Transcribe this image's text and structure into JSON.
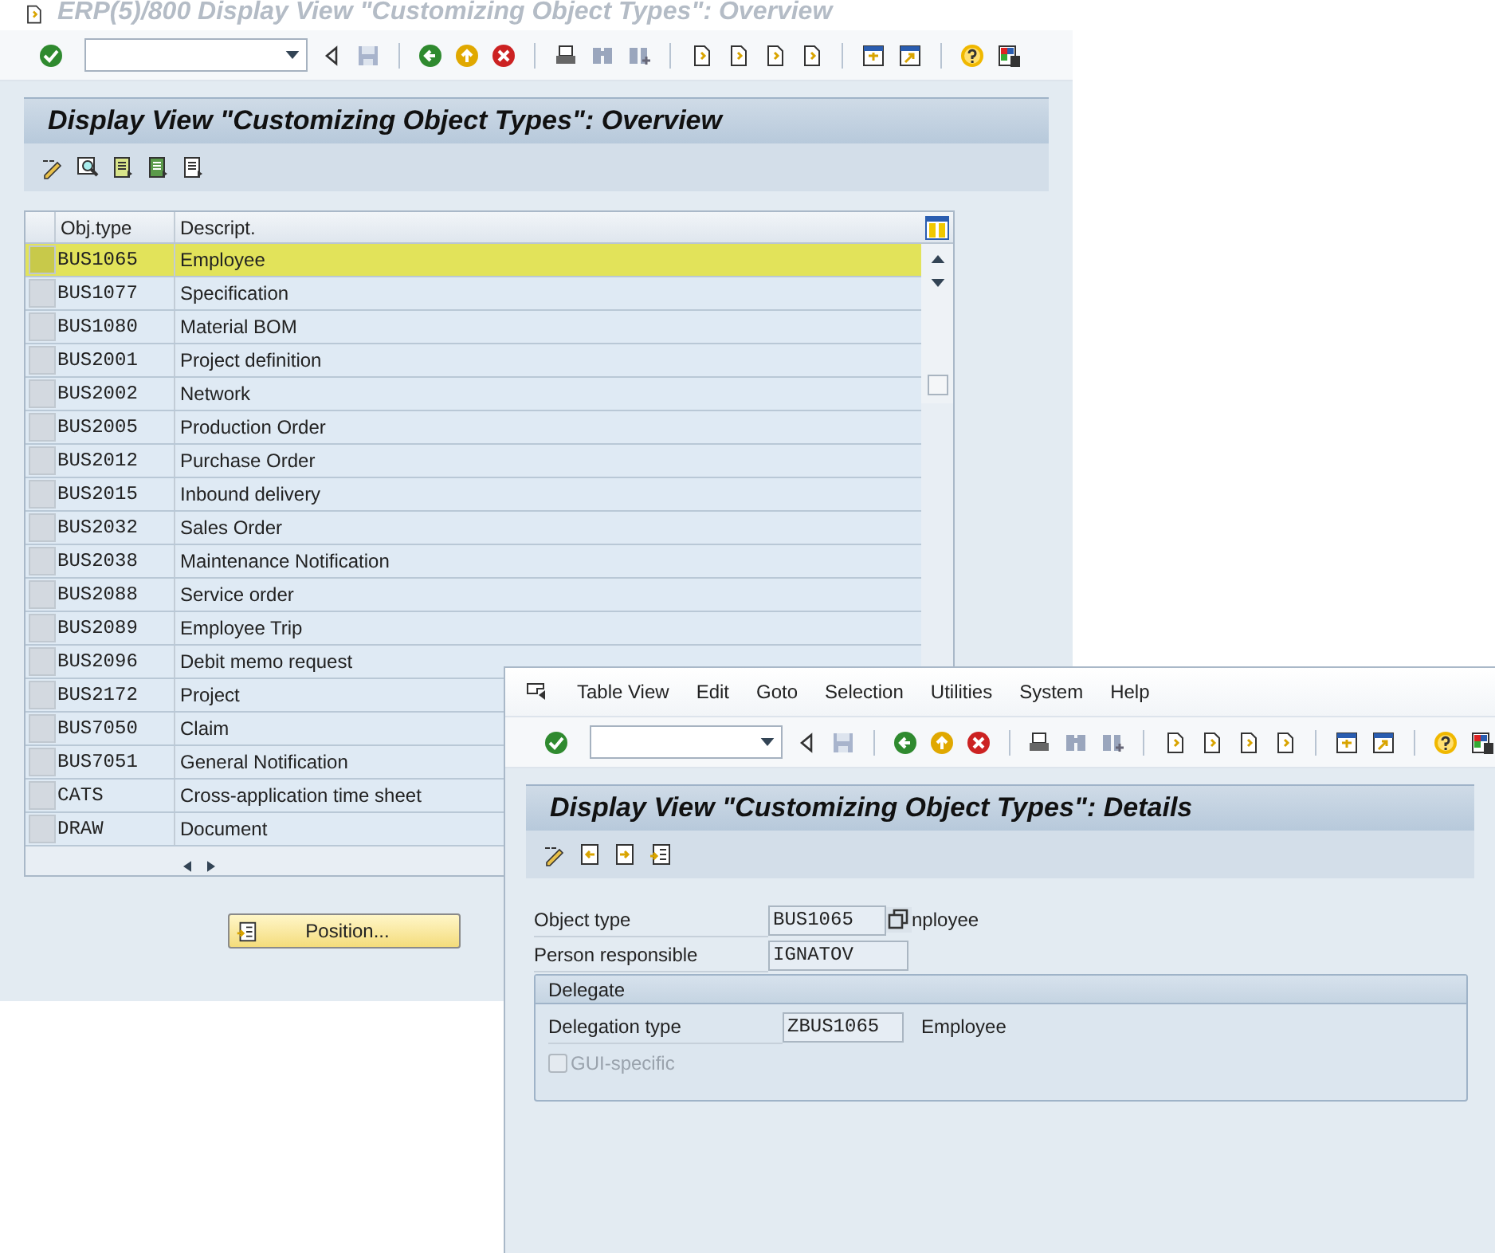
{
  "back_window": {
    "title": "ERP(5)/800 Display View \"Customizing Object Types\": Overview",
    "screen_title": "Display View \"Customizing Object Types\": Overview",
    "table": {
      "columns": [
        "Obj.type",
        "Descript."
      ],
      "rows": [
        {
          "obj_type": "BUS1065",
          "description": "Employee",
          "selected": true
        },
        {
          "obj_type": "BUS1077",
          "description": "Specification",
          "selected": false
        },
        {
          "obj_type": "BUS1080",
          "description": "Material BOM",
          "selected": false
        },
        {
          "obj_type": "BUS2001",
          "description": "Project definition",
          "selected": false
        },
        {
          "obj_type": "BUS2002",
          "description": "Network",
          "selected": false
        },
        {
          "obj_type": "BUS2005",
          "description": "Production Order",
          "selected": false
        },
        {
          "obj_type": "BUS2012",
          "description": "Purchase Order",
          "selected": false
        },
        {
          "obj_type": "BUS2015",
          "description": "Inbound delivery",
          "selected": false
        },
        {
          "obj_type": "BUS2032",
          "description": "Sales Order",
          "selected": false
        },
        {
          "obj_type": "BUS2038",
          "description": "Maintenance Notification",
          "selected": false
        },
        {
          "obj_type": "BUS2088",
          "description": "Service order",
          "selected": false
        },
        {
          "obj_type": "BUS2089",
          "description": "Employee Trip",
          "selected": false
        },
        {
          "obj_type": "BUS2096",
          "description": "Debit memo request",
          "selected": false
        },
        {
          "obj_type": "BUS2172",
          "description": "Project",
          "selected": false
        },
        {
          "obj_type": "BUS7050",
          "description": "Claim",
          "selected": false
        },
        {
          "obj_type": "BUS7051",
          "description": "General Notification",
          "selected": false
        },
        {
          "obj_type": "CATS",
          "description": "Cross-application time sheet",
          "selected": false
        },
        {
          "obj_type": "DRAW",
          "description": "Document",
          "selected": false
        }
      ]
    },
    "position_button": "Position..."
  },
  "front_window": {
    "menu": [
      "Table View",
      "Edit",
      "Goto",
      "Selection",
      "Utilities",
      "System",
      "Help"
    ],
    "screen_title": "Display View \"Customizing Object Types\": Details",
    "fields": [
      {
        "label": "Object type",
        "value": "BUS1065",
        "description": "nployee"
      },
      {
        "label": "Person responsible",
        "value": "IGNATOV"
      }
    ],
    "delegate": {
      "title": "Delegate",
      "label": "Delegation type",
      "value": "ZBUS1065",
      "description": "Employee",
      "checkbox": {
        "label": "GUI-specific",
        "checked": false,
        "disabled": true
      }
    }
  }
}
